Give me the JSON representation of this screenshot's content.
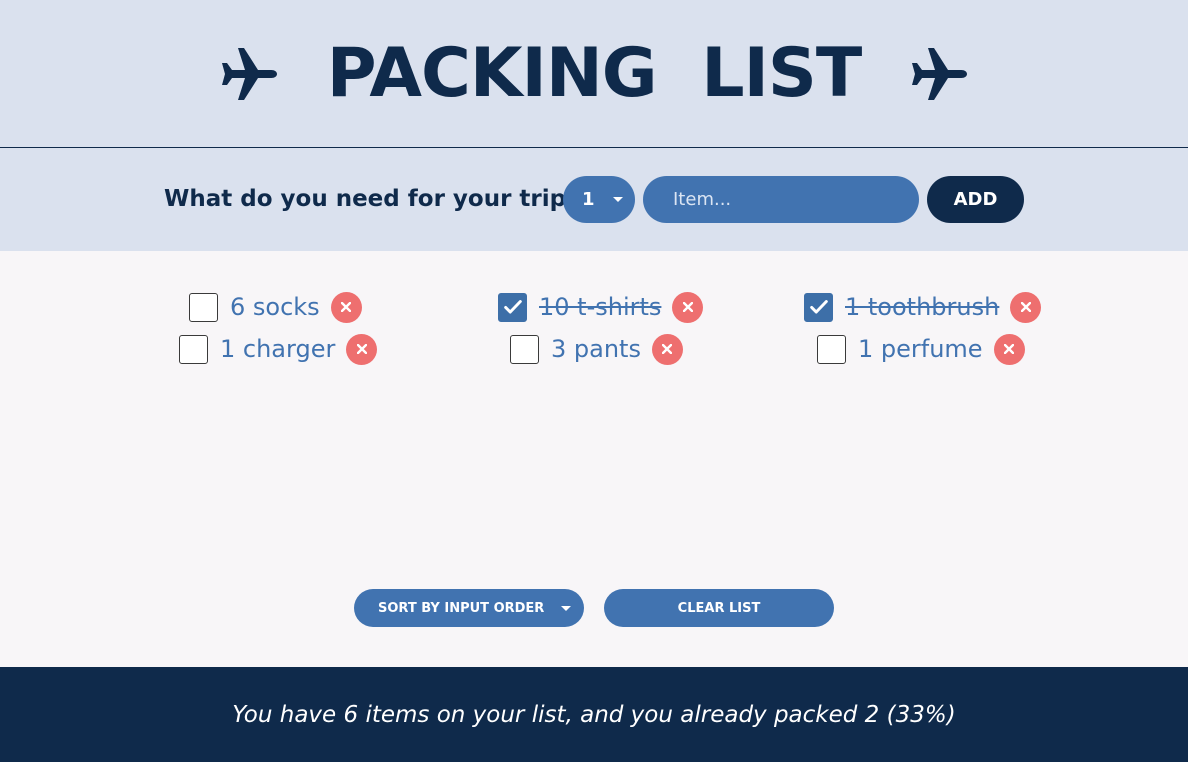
{
  "header": {
    "title": "PACKING LIST",
    "left_icon": "airplane-icon",
    "right_icon": "airplane-icon"
  },
  "form": {
    "label": "What do you need for your trip?",
    "quantity_value": "1",
    "item_placeholder": "Item...",
    "add_label": "ADD"
  },
  "items": [
    {
      "text": "6 socks",
      "packed": false
    },
    {
      "text": "10 t-shirts",
      "packed": true
    },
    {
      "text": "1 toothbrush",
      "packed": true
    },
    {
      "text": "1 charger",
      "packed": false
    },
    {
      "text": "3 pants",
      "packed": false
    },
    {
      "text": "1 perfume",
      "packed": false
    }
  ],
  "actions": {
    "sort_label": "SORT BY INPUT ORDER",
    "clear_label": "CLEAR LIST"
  },
  "stats": {
    "text": "You have 6 items on your list, and you already packed 2 (33%)"
  },
  "colors": {
    "header_bg": "#dae1ee",
    "navy": "#0f2a4b",
    "blue": "#4173b0",
    "delete_red": "#ee6f6f",
    "list_bg": "#f8f6f8"
  }
}
